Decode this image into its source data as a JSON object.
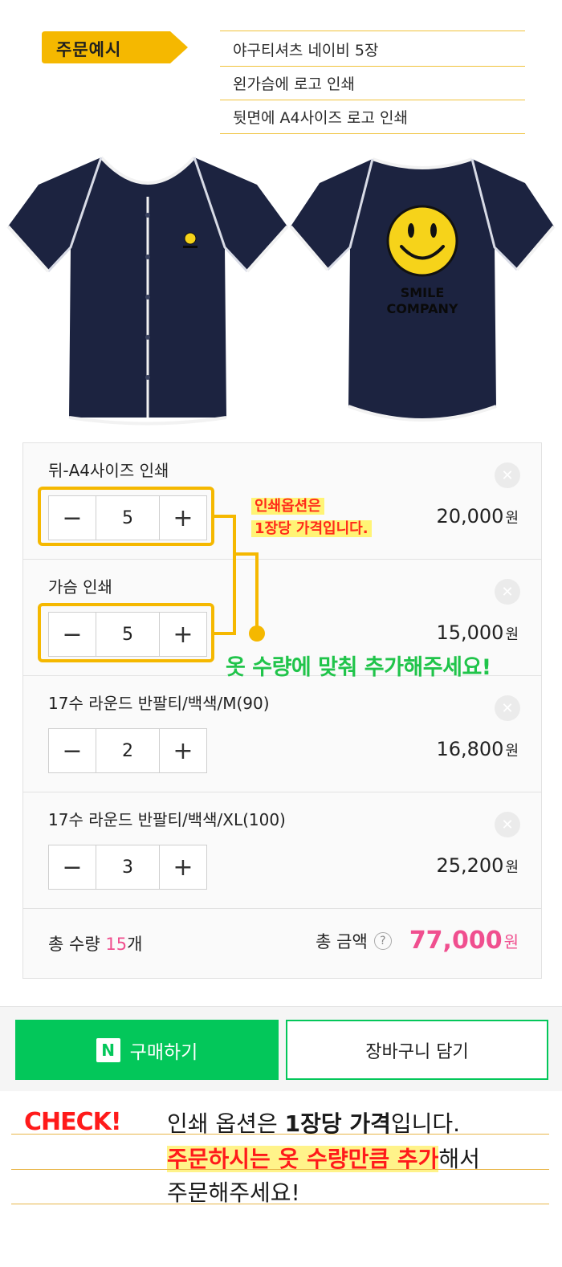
{
  "header": {
    "tag_label": "주문예시",
    "specs": [
      "야구티셔츠 네이비 5장",
      "왼가슴에 로고 인쇄",
      "뒷면에 A4사이즈 로고 인쇄"
    ]
  },
  "logo": {
    "line1": "SMILE",
    "line2": "COMPANY"
  },
  "options": [
    {
      "title": "뒤-A4사이즈 인쇄",
      "qty": "5",
      "price": "20,000",
      "won": "원"
    },
    {
      "title": "가슴 인쇄",
      "qty": "5",
      "price": "15,000",
      "won": "원"
    },
    {
      "title": "17수 라운드 반팔티/백색/M(90)",
      "qty": "2",
      "price": "16,800",
      "won": "원"
    },
    {
      "title": "17수 라운드 반팔티/백색/XL(100)",
      "qty": "3",
      "price": "25,200",
      "won": "원"
    }
  ],
  "stepper": {
    "minus": "−",
    "plus": "+"
  },
  "remove_glyph": "✕",
  "totals": {
    "qty_label": "총 수량",
    "qty_value": "15",
    "qty_unit": "개",
    "amount_label": "총 금액",
    "help": "?",
    "amount_value": "77,000",
    "won": "원"
  },
  "annotations": {
    "note_line1": "인쇄옵션은",
    "note_line2": "1장당 가격입니다.",
    "green": "옷 수량에 맞춰 추가해주세요!"
  },
  "buttons": {
    "naver_logo": "N",
    "buy": "구매하기",
    "cart": "장바구니 담기"
  },
  "check": {
    "label": "CHECK!",
    "line1_a": "인쇄 옵션은 ",
    "line1_b": "1장당 가격",
    "line1_c": "입니다.",
    "line2_a": "주문하시는 옷 수량만큼 추가",
    "line2_b": "해서",
    "line3": "주문해주세요!"
  },
  "colors": {
    "navy": "#1c2340",
    "accent_yellow": "#f5b800",
    "naver_green": "#03c75a",
    "price_pink": "#f04f8f",
    "alert_red": "#ff1a1a",
    "annot_green": "#20c44a"
  }
}
